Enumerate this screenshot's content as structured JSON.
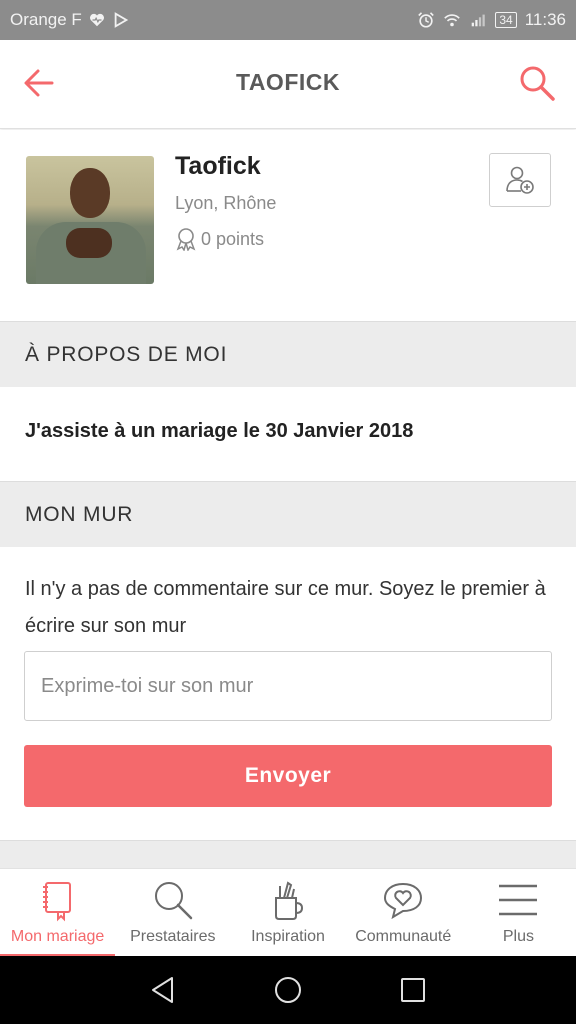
{
  "status_bar": {
    "carrier": "Orange F",
    "battery": "34",
    "time": "11:36"
  },
  "app_bar": {
    "title": "TAOFICK",
    "back_icon": "arrow-left-icon",
    "search_icon": "search-icon"
  },
  "profile": {
    "name": "Taofick",
    "location": "Lyon, Rhône",
    "points": "0 points",
    "add_friend_icon": "add-user-icon"
  },
  "about": {
    "header": "À PROPOS DE MOI",
    "text": "J'assiste à un mariage le 30 Janvier 2018"
  },
  "wall": {
    "header": "MON MUR",
    "empty_message": "Il n'y a pas de commentaire sur ce mur. Soyez le premier à écrire sur son mur",
    "input_placeholder": "Exprime-toi sur son mur",
    "send_label": "Envoyer"
  },
  "bottom_nav": {
    "items": [
      {
        "label": "Mon mariage",
        "icon": "notebook-icon",
        "active": true
      },
      {
        "label": "Prestataires",
        "icon": "search-icon",
        "active": false
      },
      {
        "label": "Inspiration",
        "icon": "pencil-cup-icon",
        "active": false
      },
      {
        "label": "Communauté",
        "icon": "heart-chat-icon",
        "active": false
      },
      {
        "label": "Plus",
        "icon": "menu-icon",
        "active": false
      }
    ]
  },
  "colors": {
    "accent": "#f4696c",
    "status_bar": "#8c8c8c",
    "section_bg": "#ececec"
  }
}
